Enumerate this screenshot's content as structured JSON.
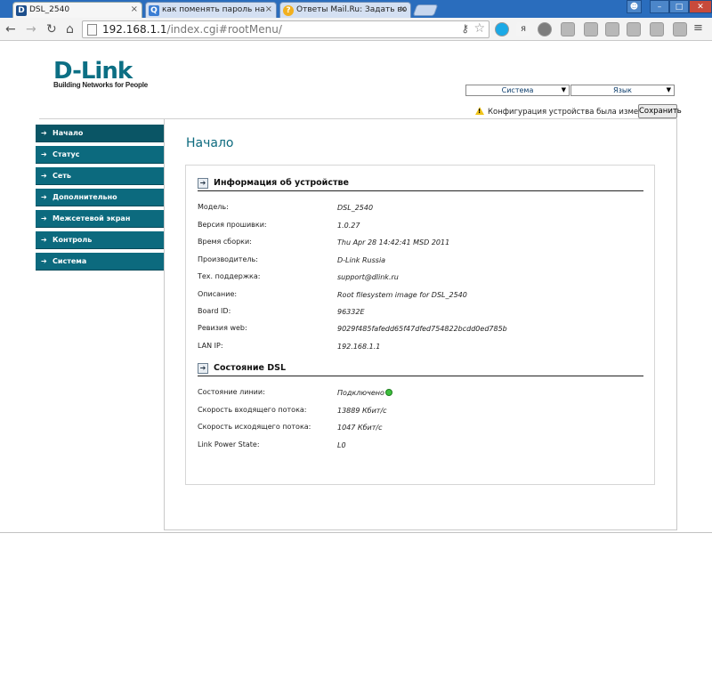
{
  "browser": {
    "tabs": [
      {
        "label": "DSL_2540",
        "favicon": "D"
      },
      {
        "label": "как поменять пароль на",
        "favicon": "Q"
      },
      {
        "label": "Ответы Mail.Ru: Задать во",
        "favicon": "?"
      }
    ],
    "url_host": "192.168.1.1",
    "url_path": "/index.cgi#rootMenu/"
  },
  "logo": {
    "name": "D-Link",
    "tagline": "Building Networks for People"
  },
  "selects": {
    "system": "Система",
    "language": "Язык"
  },
  "notice": {
    "text": "Конфигурация устройства была изменена",
    "save_label": "Сохранить"
  },
  "menu": [
    {
      "label": "Начало"
    },
    {
      "label": "Статус"
    },
    {
      "label": "Сеть"
    },
    {
      "label": "Дополнительно"
    },
    {
      "label": "Межсетевой экран"
    },
    {
      "label": "Контроль"
    },
    {
      "label": "Система"
    }
  ],
  "page_title": "Начало",
  "device_info": {
    "title": "Информация об устройстве",
    "rows": [
      {
        "label": "Модель:",
        "value": "DSL_2540"
      },
      {
        "label": "Версия прошивки:",
        "value": "1.0.27"
      },
      {
        "label": "Время сборки:",
        "value": "Thu Apr 28 14:42:41 MSD 2011"
      },
      {
        "label": "Производитель:",
        "value": "D-Link Russia"
      },
      {
        "label": "Тех. поддержка:",
        "value": "support@dlink.ru"
      },
      {
        "label": "Описание:",
        "value": "Root filesystem image for DSL_2540"
      },
      {
        "label": "Board ID:",
        "value": "96332E"
      },
      {
        "label": "Ревизия web:",
        "value": "9029f485fafedd65f47dfed754822bcdd0ed785b"
      },
      {
        "label": "LAN IP:",
        "value": "192.168.1.1"
      }
    ]
  },
  "dsl_status": {
    "title": "Состояние DSL",
    "rows": [
      {
        "label": "Состояние линии:",
        "value": "Подключено"
      },
      {
        "label": "Скорость входящего потока:",
        "value": "13889 Кбит/с"
      },
      {
        "label": "Скорость исходящего потока:",
        "value": "1047 Кбит/с"
      },
      {
        "label": "Link Power State:",
        "value": "L0"
      }
    ]
  }
}
